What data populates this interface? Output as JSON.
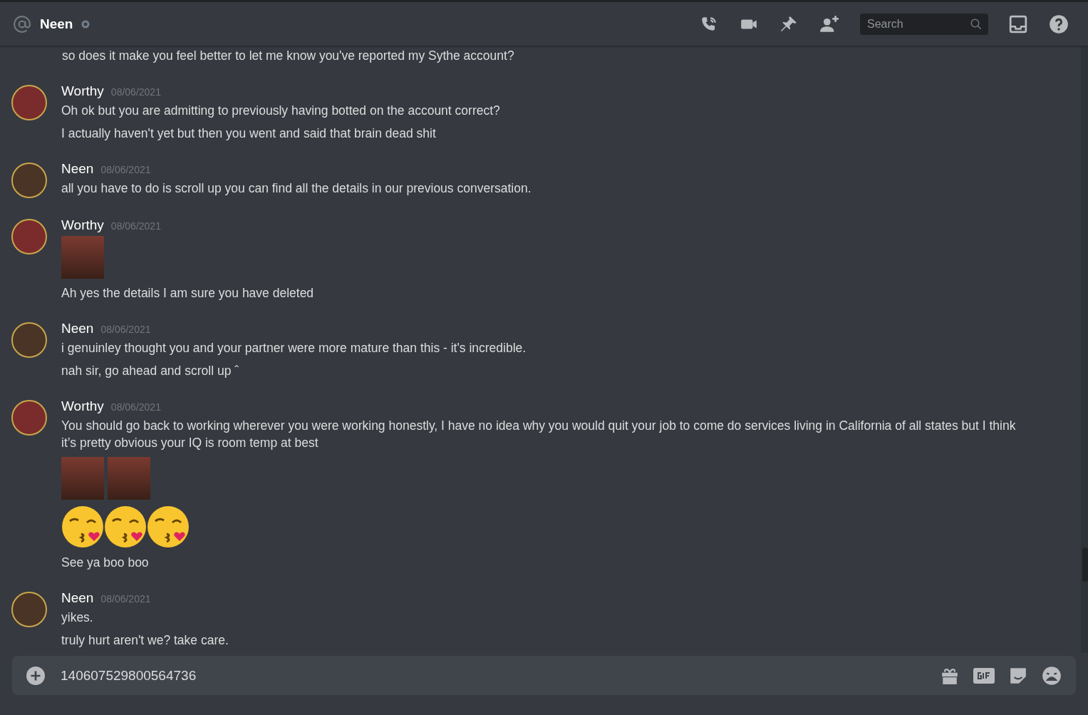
{
  "header": {
    "name": "Neen",
    "online": false,
    "search": {
      "placeholder": "Search"
    }
  },
  "messages": [
    {
      "kind": "continuation",
      "items": [
        {
          "kind": "text",
          "text": "so does it make you feel better to let me know you've reported my Sythe account?"
        }
      ]
    },
    {
      "kind": "group",
      "author": "Worthy",
      "timestamp": "08/06/2021",
      "color": "#7a2c2c",
      "items": [
        {
          "kind": "text",
          "text": "Oh ok but you are admitting to previously having botted on the account correct?"
        },
        {
          "kind": "text",
          "text": "I actually haven't yet but then you went and said that brain dead shit"
        }
      ]
    },
    {
      "kind": "group",
      "author": "Neen",
      "timestamp": "08/06/2021",
      "color": "#4a3426",
      "items": [
        {
          "kind": "text",
          "text": "all you have to do is scroll up you can find all the details in our previous conversation."
        }
      ]
    },
    {
      "kind": "group",
      "author": "Worthy",
      "timestamp": "08/06/2021",
      "color": "#7a2c2c",
      "items": [
        {
          "kind": "images",
          "images": [
            {
              "kind": "photo"
            }
          ]
        },
        {
          "kind": "text",
          "text": "Ah yes the details I am sure you have deleted"
        }
      ]
    },
    {
      "kind": "group",
      "author": "Neen",
      "timestamp": "08/06/2021",
      "color": "#4a3426",
      "items": [
        {
          "kind": "text",
          "text": "i genuinley thought you and your partner were more mature than this - it's incredible."
        },
        {
          "kind": "text",
          "text": "nah sir, go ahead and scroll up ˆ"
        }
      ]
    },
    {
      "kind": "group",
      "author": "Worthy",
      "timestamp": "08/06/2021",
      "color": "#7a2c2c",
      "items": [
        {
          "kind": "text",
          "text": "You should go back to working wherever you were working honestly, I have no idea why you would quit your job to come do services living in California of all states but I think it’s pretty obvious your IQ is room temp at best"
        },
        {
          "kind": "images",
          "images": [
            {
              "kind": "photo"
            },
            {
              "kind": "photo"
            }
          ]
        },
        {
          "kind": "emojis",
          "emojis": [
            {
              "kind": "kiss"
            },
            {
              "kind": "kiss"
            },
            {
              "kind": "kiss"
            }
          ]
        },
        {
          "kind": "text",
          "text": "See ya boo boo"
        }
      ]
    },
    {
      "kind": "group",
      "author": "Neen",
      "timestamp": "08/06/2021",
      "color": "#4a3426",
      "items": [
        {
          "kind": "text",
          "text": "yikes."
        },
        {
          "kind": "text",
          "text": "truly hurt aren't we? take care."
        }
      ]
    }
  ],
  "composer": {
    "value": "140607529800564736"
  }
}
